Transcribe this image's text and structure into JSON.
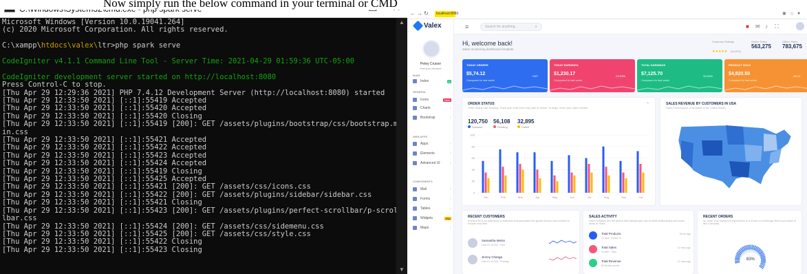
{
  "caption": "Now simply run the below command in your terminal or CMD",
  "cmd": {
    "title": "C:\\Windows\\System32\\cmd.exe - php  spark serve",
    "controls": [
      "—",
      "☐",
      "✕"
    ],
    "lines": [
      {
        "t": "Microsoft Windows [Version 10.0.19041.264]",
        "c": ""
      },
      {
        "t": "(c) 2020 Microsoft Corporation. All rights reserved.",
        "c": ""
      },
      {
        "t": "",
        "c": ""
      },
      {
        "t": "C:\\xampp\\htdocs\\valex\\ltr>php spark serve",
        "c": "prompt"
      },
      {
        "t": "",
        "c": ""
      },
      {
        "t": "CodeIgniter v4.1.1 Command Line Tool - Server Time: 2021-04-29 01:59:36 UTC-05:00",
        "c": "g"
      },
      {
        "t": "",
        "c": ""
      },
      {
        "t": "CodeIgniter development server started on http://localhost:8080",
        "c": "g"
      },
      {
        "t": "Press Control-C to stop.",
        "c": ""
      },
      {
        "t": "[Thu Apr 29 12:29:36 2021] PHP 7.4.12 Development Server (http://localhost:8080) started",
        "c": ""
      },
      {
        "t": "[Thu Apr 29 12:33:50 2021] [::1]:55419 Accepted",
        "c": ""
      },
      {
        "t": "[Thu Apr 29 12:33:50 2021] [::1]:55420 Accepted",
        "c": ""
      },
      {
        "t": "[Thu Apr 29 12:33:50 2021] [::1]:55420 Closing",
        "c": ""
      },
      {
        "t": "[Thu Apr 29 12:33:50 2021] [::1]:55419 [200]: GET /assets/plugins/bootstrap/css/bootstrap.m",
        "c": ""
      },
      {
        "t": "in.css",
        "c": ""
      },
      {
        "t": "[Thu Apr 29 12:33:50 2021] [::1]:55421 Accepted",
        "c": ""
      },
      {
        "t": "[Thu Apr 29 12:33:50 2021] [::1]:55422 Accepted",
        "c": ""
      },
      {
        "t": "[Thu Apr 29 12:33:50 2021] [::1]:55423 Accepted",
        "c": ""
      },
      {
        "t": "[Thu Apr 29 12:33:50 2021] [::1]:55424 Accepted",
        "c": ""
      },
      {
        "t": "[Thu Apr 29 12:33:50 2021] [::1]:55419 Closing",
        "c": ""
      },
      {
        "t": "[Thu Apr 29 12:33:50 2021] [::1]:55425 Accepted",
        "c": ""
      },
      {
        "t": "[Thu Apr 29 12:33:50 2021] [::1]:55421 [200]: GET /assets/css/icons.css",
        "c": ""
      },
      {
        "t": "[Thu Apr 29 12:33:50 2021] [::1]:55422 [200]: GET /assets/plugins/sidebar/sidebar.css",
        "c": ""
      },
      {
        "t": "[Thu Apr 29 12:33:50 2021] [::1]:55421 Closing",
        "c": ""
      },
      {
        "t": "[Thu Apr 29 12:33:50 2021] [::1]:55423 [200]: GET /assets/plugins/perfect-scrollbar/p-scrol",
        "c": ""
      },
      {
        "t": "lbar.css",
        "c": ""
      },
      {
        "t": "[Thu Apr 29 12:33:50 2021] [::1]:55424 [200]: GET /assets/css/sidemenu.css",
        "c": ""
      },
      {
        "t": "[Thu Apr 29 12:33:50 2021] [::1]:55425 [200]: GET /assets/css/style.css",
        "c": ""
      },
      {
        "t": "[Thu Apr 29 12:33:50 2021] [::1]:55422 Closing",
        "c": ""
      },
      {
        "t": "[Thu Apr 29 12:33:50 2021] [::1]:55423 Closing",
        "c": ""
      }
    ]
  },
  "browser": {
    "url": "localhost:8080",
    "app": {
      "logo": "Valex",
      "user_name": "Petey Cruiser",
      "user_role": "Premium Member",
      "search_placeholder": "Search for anything...",
      "sidebar": {
        "main_label": "MAIN",
        "general_label": "GENERAL",
        "webapps_label": "WEB APPS",
        "components_label": "COMPONENTS",
        "items": [
          {
            "label": "Index",
            "badge": "1",
            "badge_style": "g"
          },
          {
            "label": "Icons",
            "badge": "New",
            "badge_style": "r"
          },
          {
            "label": "Charts",
            "badge": "",
            "badge_style": ""
          },
          {
            "label": "Bootstrap",
            "badge": "",
            "badge_style": ""
          },
          {
            "label": "Apps",
            "badge": "",
            "badge_style": ""
          },
          {
            "label": "Elements",
            "badge": "",
            "badge_style": ""
          },
          {
            "label": "Advanced UI",
            "badge": "",
            "badge_style": ""
          },
          {
            "label": "Mail",
            "badge": "",
            "badge_style": ""
          },
          {
            "label": "Forms",
            "badge": "",
            "badge_style": ""
          },
          {
            "label": "Tables",
            "badge": "",
            "badge_style": ""
          },
          {
            "label": "Widgets",
            "badge": "Hot",
            "badge_style": "yl"
          },
          {
            "label": "Maps",
            "badge": "",
            "badge_style": ""
          }
        ]
      },
      "welcome": "Hi, welcome back!",
      "welcome_sub": "Sales monitoring dashboard template.",
      "stats": [
        {
          "label": "Customer Ratings",
          "value": "(14,873)"
        },
        {
          "label": "Online Sales",
          "value": "563,275"
        },
        {
          "label": "Offline Sales",
          "value": "783,675"
        }
      ],
      "cards": [
        {
          "title": "TODAY ORDERS",
          "value": "$5,74.12",
          "sub": "Compared to last week",
          "pct": "+427",
          "color": "#2e6df0"
        },
        {
          "title": "TODAY EARNINGS",
          "value": "$1,230.17",
          "sub": "Compared to last week",
          "pct": "-23.09%",
          "color": "#f0446f"
        },
        {
          "title": "TOTAL EARNINGS",
          "value": "$7,125.70",
          "sub": "Compared to last week",
          "pct": "52.09%",
          "color": "#1ebc84"
        },
        {
          "title": "PRODUCT SOLD",
          "value": "$4,820.50",
          "sub": "Compared to last week",
          "pct": "-152.3",
          "color": "#f79234"
        }
      ],
      "order_status": {
        "title": "ORDER STATUS",
        "sub": "Order Status and Tracking. Track your order from ship date to arrival. To begin, enter your order number.",
        "totals": [
          {
            "value": "120,750",
            "label": "Success",
            "color": "#285cf7"
          },
          {
            "value": "56,108",
            "label": "Pending",
            "color": "#f7557a"
          },
          {
            "value": "32,895",
            "label": "Failed",
            "color": "#fbbc04"
          }
        ]
      },
      "sales_map": {
        "title": "SALES REVENUE BY CUSTOMERS IN USA",
        "sub": "Sales Performance of all states in the United States"
      },
      "recent_customers": {
        "title": "RECENT CUSTOMERS",
        "sub": "A customer is an individual or business that purchases the goods service has evolved to include real-time",
        "items": [
          {
            "name": "Samantha Melon",
            "detail": "User ID: #1234 · Paid"
          },
          {
            "name": "Jimmy Changa",
            "detail": "User ID: #1234 · Pending"
          }
        ]
      },
      "sales_activity": {
        "title": "SALES ACTIVITY",
        "sub": "Sales activities are the tactics that salespeople use to build relationships and move deals to close.",
        "items": [
          {
            "name": "Total Products",
            "detail": "13 Item · Fcolor %",
            "time": "18 hrs ago",
            "color": "#285cf7"
          },
          {
            "name": "Total Sales",
            "detail": "1k Item · Sold",
            "time": "12 mins ago",
            "color": "#f7557a"
          },
          {
            "name": "Total Revenue",
            "detail": "$2,5k this month",
            "time": "12 mins ago",
            "color": "#2dce89"
          }
        ]
      },
      "recent_orders": {
        "title": "RECENT ORDERS",
        "sub": "An order is an investor's instructions to a broker or brokerage firm to purchase or sell a security.",
        "gauge_value": "83%"
      }
    }
  },
  "chart_data": {
    "type": "bar",
    "categories": [
      "Jan",
      "Feb",
      "Mar",
      "Apr",
      "May",
      "Jun",
      "Jul",
      "Aug",
      "Sep",
      "Oct"
    ],
    "series": [
      {
        "name": "Success",
        "values": [
          55,
          75,
          70,
          70,
          55,
          65,
          60,
          80,
          55,
          72
        ],
        "color": "#285cf7"
      },
      {
        "name": "Pending",
        "values": [
          35,
          45,
          50,
          40,
          30,
          35,
          50,
          45,
          35,
          50
        ],
        "color": "#f7557a"
      },
      {
        "name": "Failed",
        "values": [
          25,
          30,
          40,
          25,
          20,
          30,
          35,
          30,
          25,
          35
        ],
        "color": "#fbbc04"
      }
    ],
    "yticks": [
      "0",
      "20",
      "40",
      "60",
      "80",
      "100"
    ],
    "ylim": [
      0,
      100
    ],
    "grid": true
  }
}
